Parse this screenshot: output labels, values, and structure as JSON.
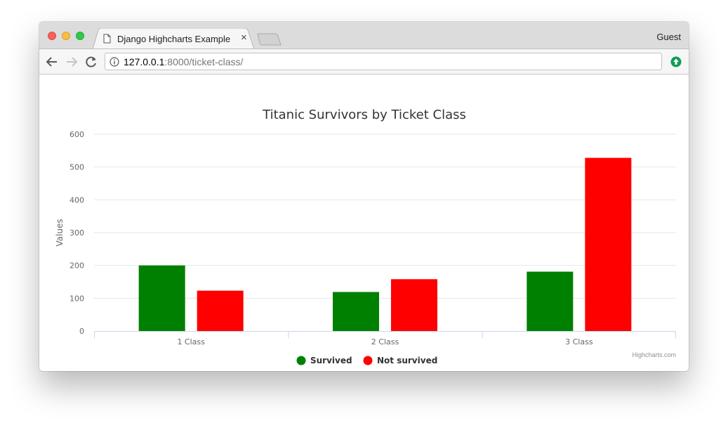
{
  "browser": {
    "tab_title": "Django Highcharts Example",
    "tab_close": "×",
    "profile_label": "Guest",
    "url_host": "127.0.0.1",
    "url_rest": ":8000/ticket-class/",
    "icons": [
      "page-icon",
      "close-icon",
      "back-arrow-icon",
      "forward-arrow-icon",
      "reload-icon",
      "info-icon",
      "extension-icon"
    ]
  },
  "chart_data": {
    "type": "bar",
    "title": "Titanic Survivors by Ticket Class",
    "xlabel": "",
    "ylabel": "Values",
    "categories": [
      "1 Class",
      "2 Class",
      "3 Class"
    ],
    "ylim": [
      0,
      600
    ],
    "yticks": [
      "0",
      "100",
      "200",
      "300",
      "400",
      "500",
      "600"
    ],
    "grid": true,
    "legend_position": "bottom",
    "series": [
      {
        "name": "Survived",
        "color": "#008000",
        "values": [
          200,
          119,
          181
        ]
      },
      {
        "name": "Not survived",
        "color": "#ff0000",
        "values": [
          123,
          158,
          528
        ]
      }
    ]
  },
  "credits": "Highcharts.com"
}
